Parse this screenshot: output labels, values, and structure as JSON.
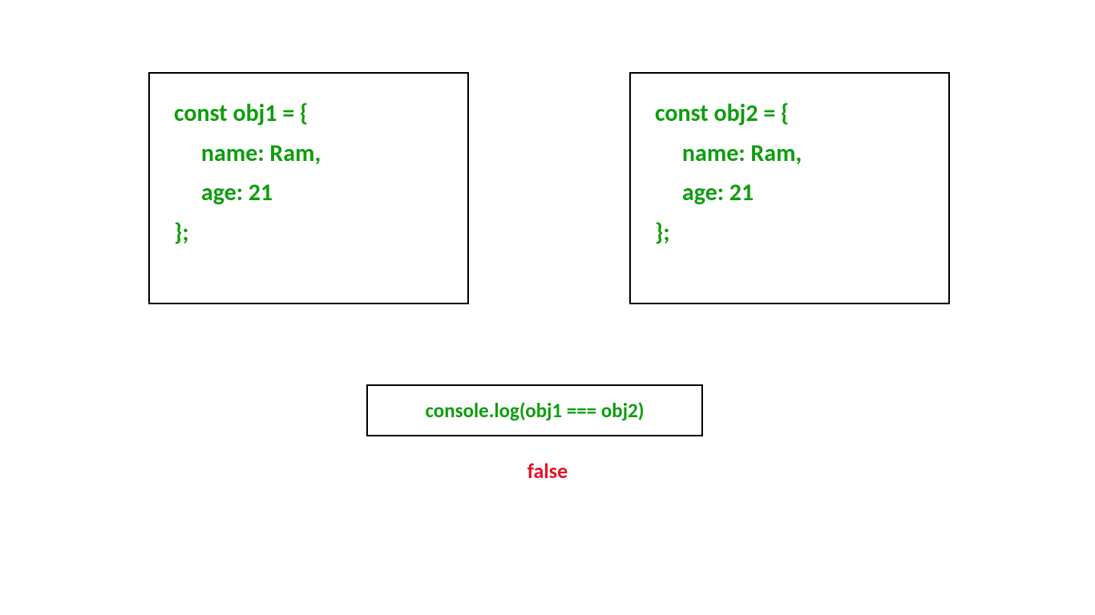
{
  "box1": {
    "line1": "const obj1 = {",
    "line2": "     name: Ram,",
    "line3": "     age: 21",
    "line4": "};"
  },
  "box2": {
    "line1": "const obj2 = {",
    "line2": "     name: Ram,",
    "line3": "     age: 21",
    "line4": "};"
  },
  "console": {
    "expression": "console.log(obj1 === obj2)"
  },
  "result": {
    "value": "false"
  }
}
